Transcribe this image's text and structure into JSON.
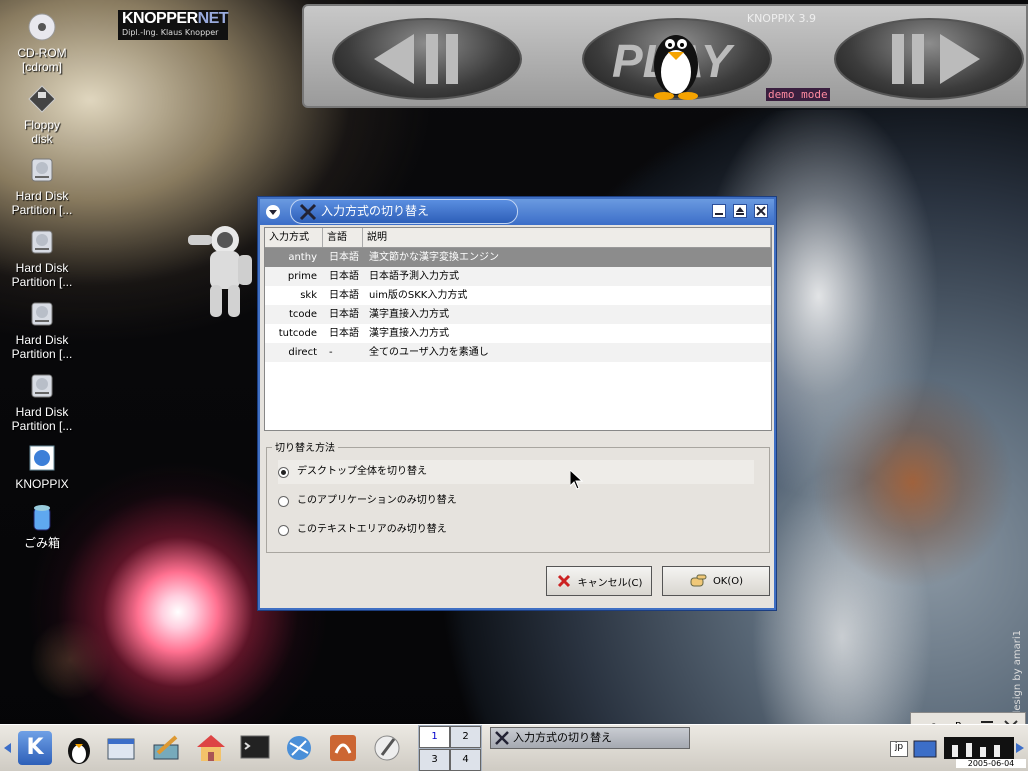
{
  "desktop": {
    "icons": [
      {
        "label": "CD-ROM\n[cdrom]",
        "icon": "cdrom-icon"
      },
      {
        "label": "Floppy\ndisk",
        "icon": "floppy-icon"
      },
      {
        "label": "Hard Disk\nPartition [...",
        "icon": "harddisk-icon"
      },
      {
        "label": "Hard Disk\nPartition [...",
        "icon": "harddisk-icon"
      },
      {
        "label": "Hard Disk\nPartition [...",
        "icon": "harddisk-icon"
      },
      {
        "label": "Hard Disk\nPartition [...",
        "icon": "harddisk-icon"
      },
      {
        "label": "KNOPPIX",
        "icon": "knoppix-icon"
      },
      {
        "label": "ごみ箱",
        "icon": "trash-icon"
      }
    ],
    "logo": {
      "line1": "KNOPPER",
      "line1b": "NET",
      "line2": "Dipl.-Ing. Klaus Knopper"
    },
    "player": {
      "version": "KNOPPIX 3.9",
      "play_label": "PLAY",
      "mode": "demo mode"
    },
    "credit": "design by amari1"
  },
  "dialog": {
    "title": "入力方式の切り替え",
    "columns": [
      "入力方式",
      "言語",
      "説明"
    ],
    "rows": [
      {
        "method": "anthy",
        "lang": "日本語",
        "desc": "連文節かな漢字変換エンジン"
      },
      {
        "method": "prime",
        "lang": "日本語",
        "desc": "日本語予測入力方式"
      },
      {
        "method": "skk",
        "lang": "日本語",
        "desc": "uim版のSKK入力方式"
      },
      {
        "method": "tcode",
        "lang": "日本語",
        "desc": "漢字直接入力方式"
      },
      {
        "method": "tutcode",
        "lang": "日本語",
        "desc": "漢字直接入力方式"
      },
      {
        "method": "direct",
        "lang": "-",
        "desc": "全てのユーザ入力を素通し"
      }
    ],
    "selected_row": "anthy",
    "group_label": "切り替え方法",
    "options": [
      {
        "label": "デスクトップ全体を切り替え",
        "checked": true
      },
      {
        "label": "このアプリケーションのみ切り替え",
        "checked": false
      },
      {
        "label": "このテキストエリアのみ切り替え",
        "checked": false
      }
    ],
    "cancel_label": "キャンセル(C)",
    "ok_label": "OK(O)"
  },
  "taskbar": {
    "pager": [
      "1",
      "2",
      "3",
      "4"
    ],
    "active_desktop": "1",
    "task_label": "入力方式の切り替え",
    "tray": {
      "a": "a",
      "r": "R",
      "lang": "jp",
      "date": "2005-06-04"
    }
  },
  "colors": {
    "title_blue": "#3c6ec8",
    "selected_row": "#8c8c8c",
    "demo_text": "#ff8aa0"
  }
}
